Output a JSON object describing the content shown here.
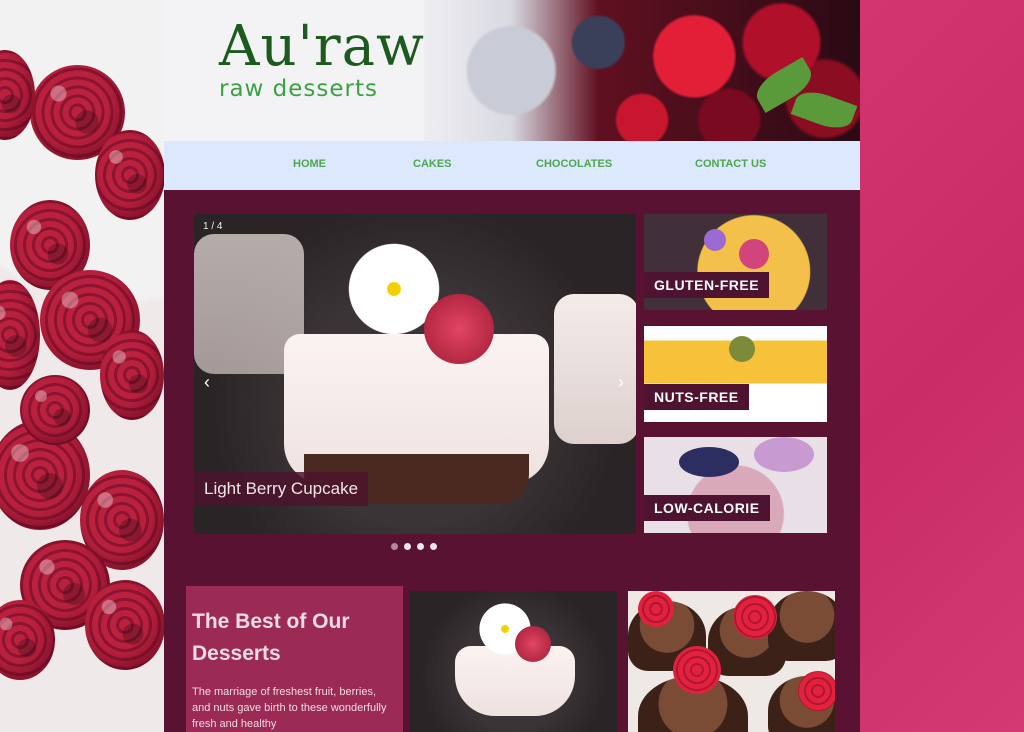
{
  "brand": {
    "logo": "Au'raw",
    "tagline": "raw desserts",
    "logo_color": "#1c5a1e",
    "tagline_color": "#3aa242"
  },
  "nav": {
    "items": [
      {
        "label": "HOME"
      },
      {
        "label": "CAKES"
      },
      {
        "label": "CHOCOLATES"
      },
      {
        "label": "CONTACT US"
      }
    ],
    "background": "#dce8fb",
    "text_color": "#4ea64e"
  },
  "slider": {
    "counter": "1 / 4",
    "caption": "Light Berry Cupcake",
    "prev_icon": "‹",
    "next_icon": "›",
    "dots": 4,
    "active_dot": 1
  },
  "categories": [
    {
      "label": "GLUTEN-FREE"
    },
    {
      "label": "NUTS-FREE"
    },
    {
      "label": "LOW-CALORIE"
    }
  ],
  "best": {
    "title": "The Best of Our Desserts",
    "text": "The marriage of freshest fruit, berries, and nuts gave birth to these wonderfully fresh and healthy"
  },
  "colors": {
    "page_background": "#d2356e",
    "content_background": "#5a1233",
    "accent": "#9b2a55"
  }
}
